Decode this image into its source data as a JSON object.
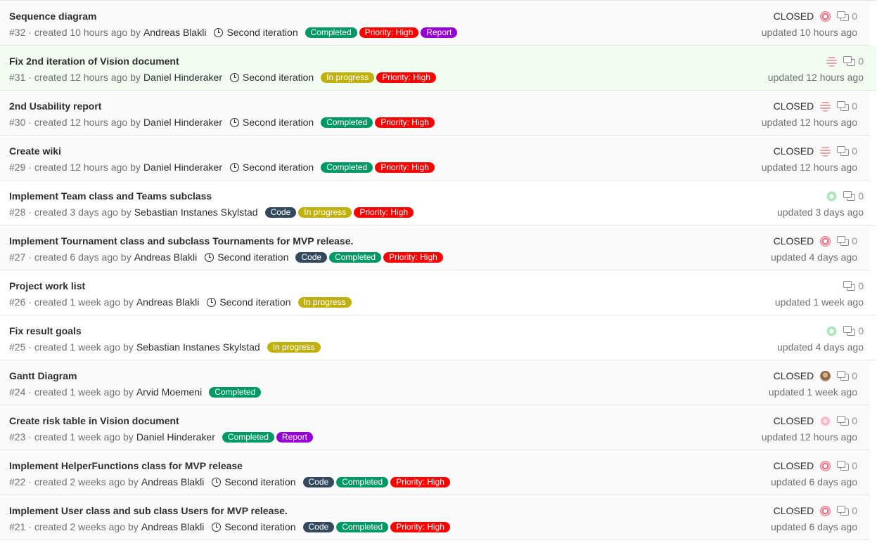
{
  "issues": [
    {
      "title": "Sequence diagram",
      "ref": "#32",
      "created": "created 10 hours ago",
      "by": "by",
      "author": "Andreas Blakli",
      "milestone": "Second iteration",
      "labels": [
        {
          "text": "Completed",
          "color": "#009966"
        },
        {
          "text": "Priority: High",
          "color": "#ff0000"
        },
        {
          "text": "Report",
          "color": "#9400d3"
        }
      ],
      "status": "CLOSED",
      "avatar": "av-pink",
      "comments": "0",
      "updated": "updated 10 hours ago",
      "bg": "closed"
    },
    {
      "title": "Fix 2nd iteration of Vision document",
      "ref": "#31",
      "created": "created 12 hours ago",
      "by": "by",
      "author": "Daniel Hinderaker",
      "milestone": "Second iteration",
      "labels": [
        {
          "text": "In progress",
          "color": "#c0b10e"
        },
        {
          "text": "Priority: High",
          "color": "#ff0000"
        }
      ],
      "status": "",
      "avatar": "av-grid",
      "comments": "0",
      "updated": "updated 12 hours ago",
      "bg": "highlight"
    },
    {
      "title": "2nd Usability report",
      "ref": "#30",
      "created": "created 12 hours ago",
      "by": "by",
      "author": "Daniel Hinderaker",
      "milestone": "Second iteration",
      "labels": [
        {
          "text": "Completed",
          "color": "#009966"
        },
        {
          "text": "Priority: High",
          "color": "#ff0000"
        }
      ],
      "status": "CLOSED",
      "avatar": "av-grid",
      "comments": "0",
      "updated": "updated 12 hours ago",
      "bg": "closed"
    },
    {
      "title": "Create wiki",
      "ref": "#29",
      "created": "created 12 hours ago",
      "by": "by",
      "author": "Daniel Hinderaker",
      "milestone": "Second iteration",
      "labels": [
        {
          "text": "Completed",
          "color": "#009966"
        },
        {
          "text": "Priority: High",
          "color": "#ff0000"
        }
      ],
      "status": "CLOSED",
      "avatar": "av-grid",
      "comments": "0",
      "updated": "updated 12 hours ago",
      "bg": "closed"
    },
    {
      "title": "Implement Team class and Teams subclass",
      "ref": "#28",
      "created": "created 3 days ago",
      "by": "by",
      "author": "Sebastian Instanes Skylstad",
      "milestone": "",
      "labels": [
        {
          "text": "Code",
          "color": "#34495e"
        },
        {
          "text": "In progress",
          "color": "#c0b10e"
        },
        {
          "text": "Priority: High",
          "color": "#ff0000"
        }
      ],
      "status": "",
      "avatar": "av-green",
      "comments": "0",
      "updated": "updated 3 days ago",
      "bg": "open"
    },
    {
      "title": "Implement Tournament class and subclass Tournaments for MVP release.",
      "ref": "#27",
      "created": "created 6 days ago",
      "by": "by",
      "author": "Andreas Blakli",
      "milestone": "Second iteration",
      "labels": [
        {
          "text": "Code",
          "color": "#34495e"
        },
        {
          "text": "Completed",
          "color": "#009966"
        },
        {
          "text": "Priority: High",
          "color": "#ff0000"
        }
      ],
      "status": "CLOSED",
      "avatar": "av-pink",
      "comments": "0",
      "updated": "updated 4 days ago",
      "bg": "closed"
    },
    {
      "title": "Project work list",
      "ref": "#26",
      "created": "created 1 week ago",
      "by": "by",
      "author": "Andreas Blakli",
      "milestone": "Second iteration",
      "labels": [
        {
          "text": "In progress",
          "color": "#c0b10e"
        }
      ],
      "status": "",
      "avatar": "",
      "comments": "0",
      "updated": "updated 1 week ago",
      "bg": "open"
    },
    {
      "title": "Fix result goals",
      "ref": "#25",
      "created": "created 1 week ago",
      "by": "by",
      "author": "Sebastian Instanes Skylstad",
      "milestone": "",
      "labels": [
        {
          "text": "In progress",
          "color": "#c0b10e"
        }
      ],
      "status": "",
      "avatar": "av-green",
      "comments": "0",
      "updated": "updated 4 days ago",
      "bg": "open"
    },
    {
      "title": "Gantt Diagram",
      "ref": "#24",
      "created": "created 1 week ago",
      "by": "by",
      "author": "Arvid Moemeni",
      "milestone": "",
      "labels": [
        {
          "text": "Completed",
          "color": "#009966"
        }
      ],
      "status": "CLOSED",
      "avatar": "av-photo",
      "comments": "0",
      "updated": "updated 1 week ago",
      "bg": "closed"
    },
    {
      "title": "Create risk table in Vision document",
      "ref": "#23",
      "created": "created 1 week ago",
      "by": "by",
      "author": "Daniel Hinderaker",
      "milestone": "",
      "labels": [
        {
          "text": "Completed",
          "color": "#009966"
        },
        {
          "text": "Report",
          "color": "#9400d3"
        }
      ],
      "status": "CLOSED",
      "avatar": "av-light",
      "comments": "0",
      "updated": "updated 12 hours ago",
      "bg": "closed"
    },
    {
      "title": "Implement HelperFunctions class for MVP release",
      "ref": "#22",
      "created": "created 2 weeks ago",
      "by": "by",
      "author": "Andreas Blakli",
      "milestone": "Second iteration",
      "labels": [
        {
          "text": "Code",
          "color": "#34495e"
        },
        {
          "text": "Completed",
          "color": "#009966"
        },
        {
          "text": "Priority: High",
          "color": "#ff0000"
        }
      ],
      "status": "CLOSED",
      "avatar": "av-pink",
      "comments": "0",
      "updated": "updated 6 days ago",
      "bg": "closed"
    },
    {
      "title": "Implement User class and sub class Users for MVP release.",
      "ref": "#21",
      "created": "created 2 weeks ago",
      "by": "by",
      "author": "Andreas Blakli",
      "milestone": "Second iteration",
      "labels": [
        {
          "text": "Code",
          "color": "#34495e"
        },
        {
          "text": "Completed",
          "color": "#009966"
        },
        {
          "text": "Priority: High",
          "color": "#ff0000"
        }
      ],
      "status": "CLOSED",
      "avatar": "av-pink",
      "comments": "0",
      "updated": "updated 6 days ago",
      "bg": "closed"
    }
  ]
}
